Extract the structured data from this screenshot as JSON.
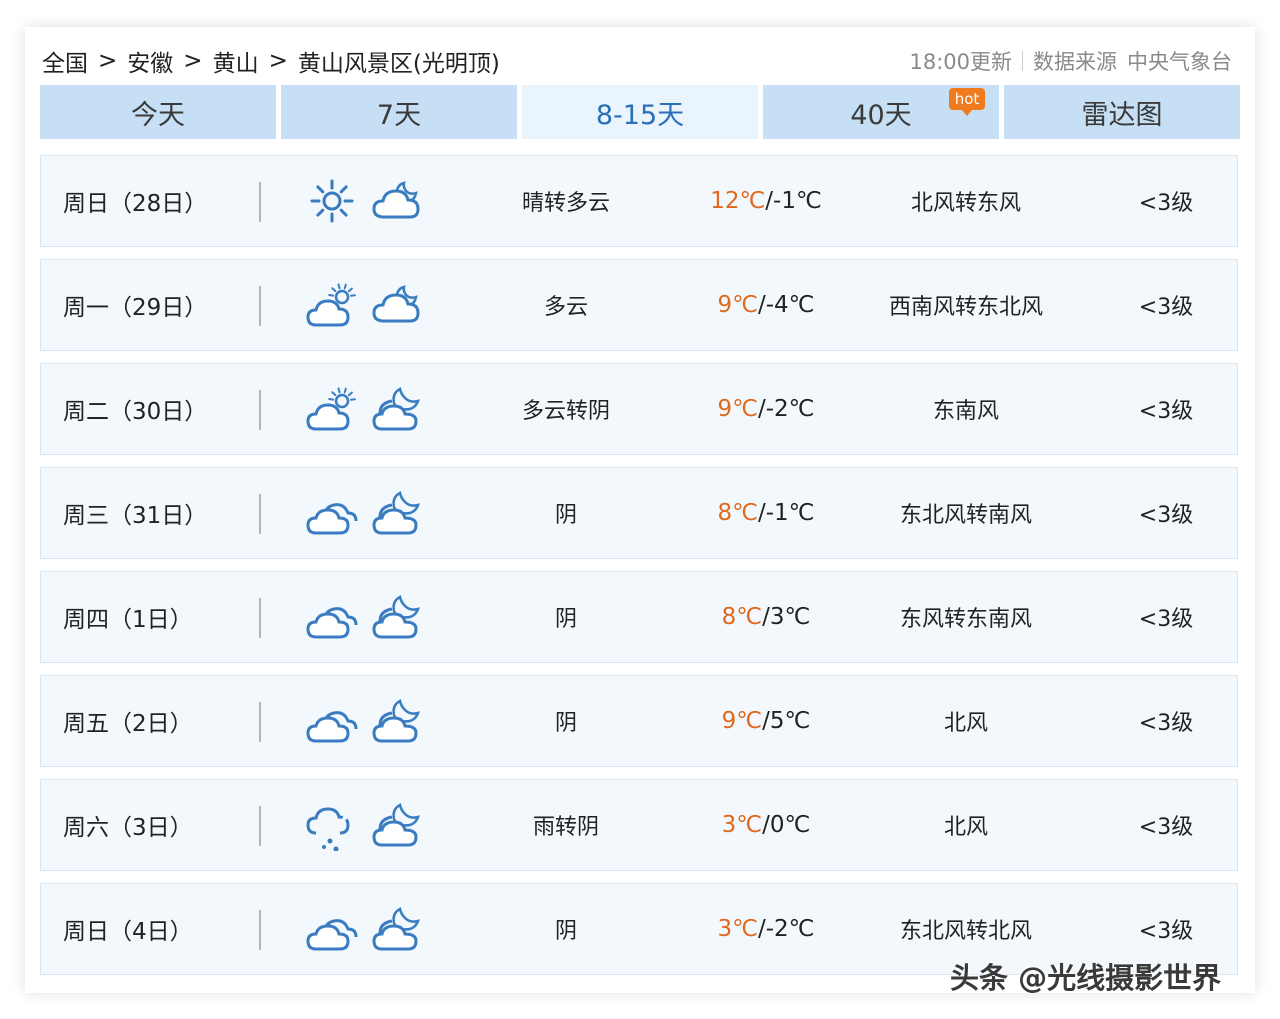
{
  "breadcrumb": [
    "全国",
    "安徽",
    "黄山",
    "黄山风景区(光明顶)"
  ],
  "breadcrumb_separator": ">",
  "meta": {
    "update_time": "18:00更新",
    "source_label": "数据来源",
    "source_name": "中央气象台"
  },
  "tabs": [
    {
      "label": "今天",
      "active": false
    },
    {
      "label": "7天",
      "active": false
    },
    {
      "label": "8-15天",
      "active": true
    },
    {
      "label": "40天",
      "active": false,
      "badge": "hot"
    },
    {
      "label": "雷达图",
      "active": false
    }
  ],
  "colors": {
    "accent": "#2a6fb7",
    "tab_bg": "#c6dff4",
    "high_temp": "#e0691d",
    "badge": "#f07a1e",
    "icon": "#3a7cc0"
  },
  "forecast": [
    {
      "day": "周日（28日）",
      "day_icon": "sunny-icon",
      "night_icon": "cloudy-night-icon",
      "weather": "晴转多云",
      "high": "12℃",
      "low": "/-1℃",
      "wind": "北风转东风",
      "level": "<3级"
    },
    {
      "day": "周一（29日）",
      "day_icon": "partly-cloudy-icon",
      "night_icon": "cloudy-night-icon",
      "weather": "多云",
      "high": "9℃",
      "low": "/-4℃",
      "wind": "西南风转东北风",
      "level": "<3级"
    },
    {
      "day": "周二（30日）",
      "day_icon": "partly-cloudy-icon",
      "night_icon": "overcast-night-icon",
      "weather": "多云转阴",
      "high": "9℃",
      "low": "/-2℃",
      "wind": "东南风",
      "level": "<3级"
    },
    {
      "day": "周三（31日）",
      "day_icon": "overcast-icon",
      "night_icon": "overcast-night-icon",
      "weather": "阴",
      "high": "8℃",
      "low": "/-1℃",
      "wind": "东北风转南风",
      "level": "<3级"
    },
    {
      "day": "周四（1日）",
      "day_icon": "overcast-icon",
      "night_icon": "overcast-night-icon",
      "weather": "阴",
      "high": "8℃",
      "low": "/3℃",
      "wind": "东风转东南风",
      "level": "<3级"
    },
    {
      "day": "周五（2日）",
      "day_icon": "overcast-icon",
      "night_icon": "overcast-night-icon",
      "weather": "阴",
      "high": "9℃",
      "low": "/5℃",
      "wind": "北风",
      "level": "<3级"
    },
    {
      "day": "周六（3日）",
      "day_icon": "rain-icon",
      "night_icon": "overcast-night-icon",
      "weather": "雨转阴",
      "high": "3℃",
      "low": "/0℃",
      "wind": "北风",
      "level": "<3级"
    },
    {
      "day": "周日（4日）",
      "day_icon": "overcast-icon",
      "night_icon": "overcast-night-icon",
      "weather": "阴",
      "high": "3℃",
      "low": "/-2℃",
      "wind": "东北风转北风",
      "level": "<3级"
    }
  ],
  "watermark": "头条 @光线摄影世界"
}
